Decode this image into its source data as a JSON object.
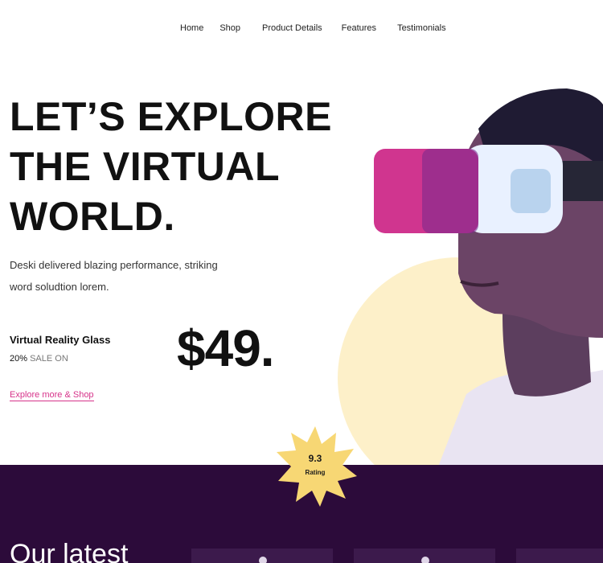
{
  "nav": {
    "items": [
      "Home",
      "Shop",
      "Product Details",
      "Features",
      "Testimonials"
    ]
  },
  "hero": {
    "title_lines": [
      "LET’S EXPLORE",
      "THE VIRTUAL",
      "WORLD."
    ],
    "description_lines": [
      "Deski delivered blazing  performance, striking",
      "word soludtion lorem."
    ],
    "product_name": "Virtual Reality Glass",
    "sale_percent": "20%",
    "sale_text": "SALE ON",
    "price": "$49.",
    "cta": "Explore more & Shop"
  },
  "rating": {
    "score": "9.3",
    "label": "Rating"
  },
  "section": {
    "title": "Our latest"
  },
  "colors": {
    "accent": "#d6338a",
    "dark_band": "#2c0b3a",
    "badge": "#f7d774",
    "glow": "#fdf0c9"
  }
}
